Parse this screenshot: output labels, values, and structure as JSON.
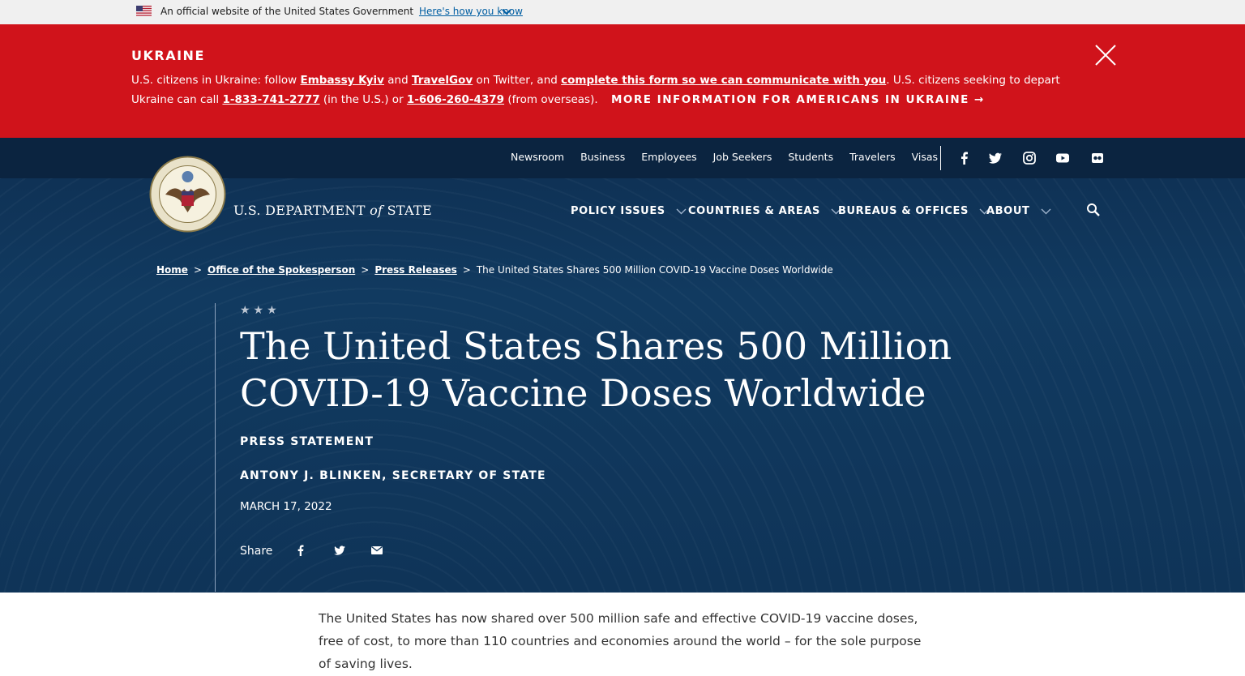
{
  "gov_banner": {
    "text": "An official website of the United States Government",
    "link": "Here's how you know",
    "icons": [
      "us-flag-icon",
      "chevron-down-icon"
    ]
  },
  "alert": {
    "title": "UKRAINE",
    "text_1": "U.S. citizens in Ukraine: follow",
    "link_embassy": "Embassy Kyiv",
    "and": "and",
    "link_travelgov": "TravelGov",
    "text_2": "on Twitter, and",
    "link_form": "complete this form so we can communicate with you",
    "text_3": ". U.S. citizens seeking to depart Ukraine can call",
    "phone_us": "1-833-741-2777",
    "text_4": "(in the U.S.) or",
    "phone_overseas": "1-606-260-4379",
    "text_5": "(from overseas).",
    "more_link": "MORE INFORMATION FOR AMERICANS IN UKRAINE →",
    "close_icon": "close-icon"
  },
  "utility_nav": [
    "Newsroom",
    "Business",
    "Employees",
    "Job Seekers",
    "Students",
    "Travelers",
    "Visas"
  ],
  "social_icons": [
    "facebook-icon",
    "twitter-icon",
    "instagram-icon",
    "youtube-icon",
    "flickr-icon"
  ],
  "brand": {
    "name_1": "U.S. DEPARTMENT",
    "name_of": "of",
    "name_2": "STATE"
  },
  "main_nav": [
    "POLICY ISSUES",
    "COUNTRIES & AREAS",
    "BUREAUS & OFFICES",
    "ABOUT"
  ],
  "breadcrumb": {
    "home": "Home",
    "spokesperson": "Office of the Spokesperson",
    "press": "Press Releases",
    "current": "The United States Shares 500 Million COVID-19 Vaccine Doses Worldwide",
    "separator": ">"
  },
  "article": {
    "stars": "★★★",
    "title": "The United States Shares 500 Million COVID-19 Vaccine Doses Worldwide",
    "type": "PRESS STATEMENT",
    "author": "ANTONY J. BLINKEN, SECRETARY OF STATE",
    "date": "MARCH 17, 2022",
    "share_label": "Share",
    "intro": "The United States has now shared over 500 million safe and effective COVID-19 vaccine doses, free of cost, to more than 110 countries and economies around the world – for the sole purpose of saving lives."
  },
  "colors": {
    "alert_red": "#d0131b",
    "navy": "#0f3458",
    "utility_navy": "#0b2440",
    "gov_gray": "#f0f0f0",
    "link_blue": "#005ea2"
  }
}
